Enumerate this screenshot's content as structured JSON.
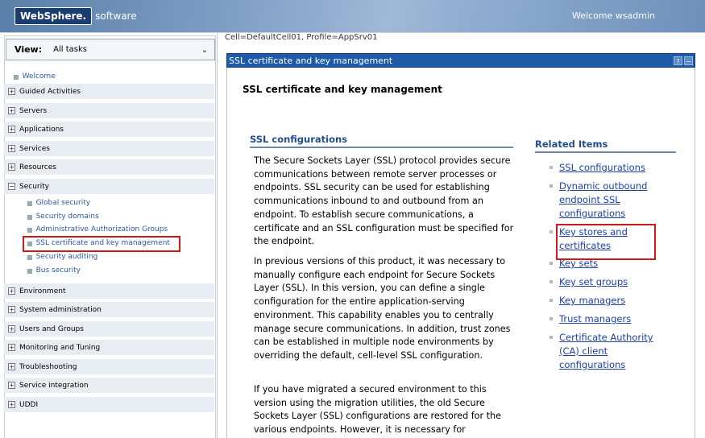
{
  "header": {
    "logo_brand": "WebSphere.",
    "logo_suffix": "software",
    "welcome": "Welcome wsadmin"
  },
  "nav": {
    "view_label": "View:",
    "view_value": "All tasks",
    "welcome": "Welcome",
    "sections": [
      {
        "label": "Guided Activities",
        "state": "+"
      },
      {
        "label": "Servers",
        "state": "+"
      },
      {
        "label": "Applications",
        "state": "+"
      },
      {
        "label": "Services",
        "state": "+"
      },
      {
        "label": "Resources",
        "state": "+"
      },
      {
        "label": "Security",
        "state": "−"
      },
      {
        "label": "Environment",
        "state": "+"
      },
      {
        "label": "System administration",
        "state": "+"
      },
      {
        "label": "Users and Groups",
        "state": "+"
      },
      {
        "label": "Monitoring and Tuning",
        "state": "+"
      },
      {
        "label": "Troubleshooting",
        "state": "+"
      },
      {
        "label": "Service integration",
        "state": "+"
      },
      {
        "label": "UDDI",
        "state": "+"
      }
    ],
    "security_items": [
      "Global security",
      "Security domains",
      "Administrative Authorization Groups",
      "SSL certificate and key management",
      "Security auditing",
      "Bus security"
    ]
  },
  "main": {
    "breadcrumb": "Cell=DefaultCell01, Profile=AppSrv01",
    "panel_title": "SSL certificate and key management",
    "help_btn": "?",
    "min_btn": "−",
    "page_title": "SSL certificate and key management",
    "section_title": "SSL configurations",
    "paragraphs": [
      "The Secure Sockets Layer (SSL) protocol provides secure communications between remote server processes or endpoints. SSL security can be used for establishing communications inbound to and outbound from an endpoint. To establish secure communications, a certificate and an SSL configuration must be specified for the endpoint.",
      "In previous versions of this product, it was necessary to manually configure each endpoint for Secure Sockets Layer (SSL). In this version, you can define a single configuration for the entire application-serving environment. This capability enables you to centrally manage secure communications. In addition, trust zones can be established in multiple node environments by overriding the default, cell-level SSL configuration.",
      "If you have migrated a secured environment to this version using the migration utilities, the old Secure Sockets Layer (SSL) configurations are restored for the various endpoints. However, it is necessary for"
    ],
    "related_title": "Related Items",
    "related_items": [
      "SSL configurations",
      "Dynamic outbound endpoint SSL configurations",
      "Key stores and certificates",
      "Key sets",
      "Key set groups",
      "Key managers",
      "Trust managers",
      "Certificate Authority (CA) client configurations"
    ]
  }
}
